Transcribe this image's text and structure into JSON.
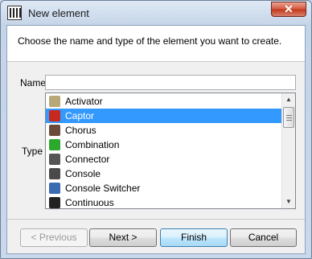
{
  "window": {
    "title": "New element",
    "close_label": "✕"
  },
  "instruction": "Choose the name and type of the element you want to create.",
  "form": {
    "name_label": "Name",
    "name_value": "",
    "type_label": "Type"
  },
  "types": [
    {
      "label": "Activator",
      "icon": "gear-icon",
      "color": "#b8a878",
      "selected": false
    },
    {
      "label": "Captor",
      "icon": "captor-icon",
      "color": "#c8281e",
      "selected": true
    },
    {
      "label": "Chorus",
      "icon": "chorus-icon",
      "color": "#6a4a3a",
      "selected": false
    },
    {
      "label": "Combination",
      "icon": "combination-icon",
      "color": "#2ca82c",
      "selected": false
    },
    {
      "label": "Connector",
      "icon": "connector-icon",
      "color": "#555555",
      "selected": false
    },
    {
      "label": "Console",
      "icon": "console-icon",
      "color": "#4a4a4a",
      "selected": false
    },
    {
      "label": "Console Switcher",
      "icon": "console-switcher-icon",
      "color": "#3a6ab0",
      "selected": false
    },
    {
      "label": "Continuous",
      "icon": "continuous-icon",
      "color": "#222222",
      "selected": false
    }
  ],
  "buttons": {
    "previous": "< Previous",
    "next": "Next >",
    "finish": "Finish",
    "cancel": "Cancel"
  }
}
